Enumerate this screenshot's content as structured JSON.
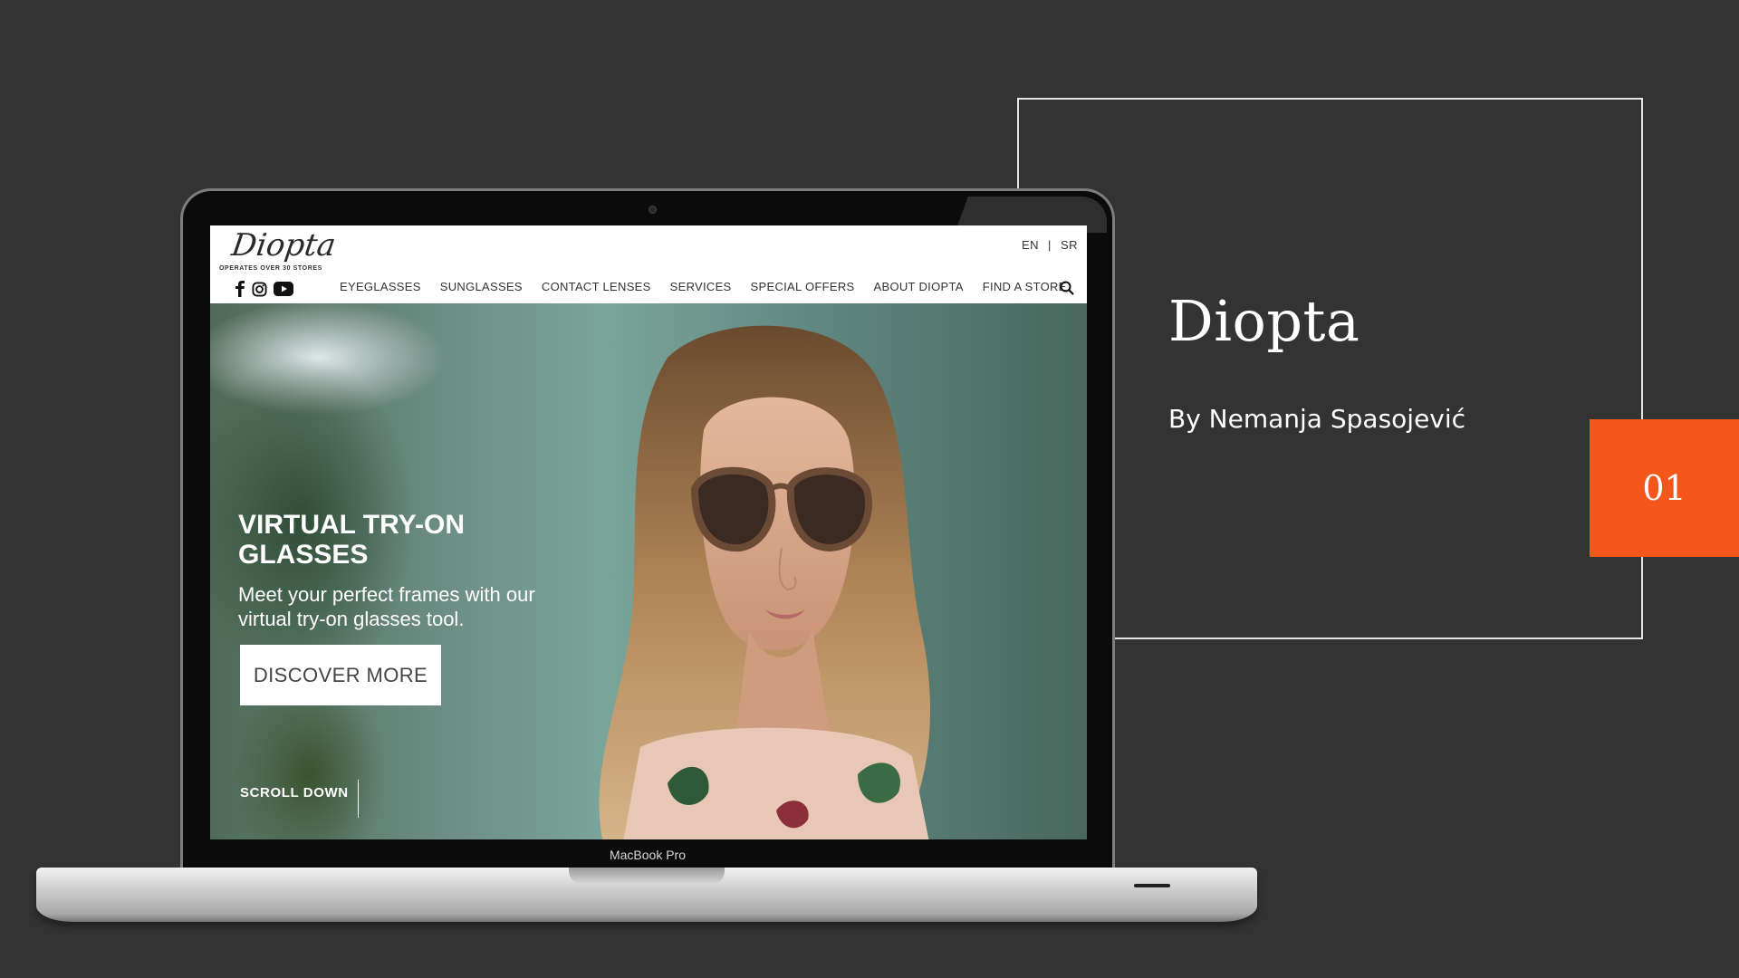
{
  "slide": {
    "title": "Diopta",
    "author": "By Nemanja Spasojević",
    "number": "01",
    "accent_color": "#f4561b",
    "background_color": "#333333"
  },
  "device": {
    "model_label": "MacBook Pro"
  },
  "website": {
    "logo": "Diopta",
    "tagline": "OPERATES OVER 30 STORES",
    "languages": [
      "EN",
      "SR"
    ],
    "lang_separator": "|",
    "social_icons": [
      "facebook-icon",
      "instagram-icon",
      "youtube-icon"
    ],
    "nav": [
      "EYEGLASSES",
      "SUNGLASSES",
      "CONTACT LENSES",
      "SERVICES",
      "SPECIAL OFFERS",
      "ABOUT DIOPTA",
      "FIND A STORE"
    ],
    "search_icon": "search-icon",
    "hero": {
      "title": "VIRTUAL TRY-ON GLASSES",
      "subtitle": "Meet your perfect frames with our virtual try-on glasses tool.",
      "button": "DISCOVER MORE",
      "scroll": "SCROLL DOWN"
    }
  }
}
